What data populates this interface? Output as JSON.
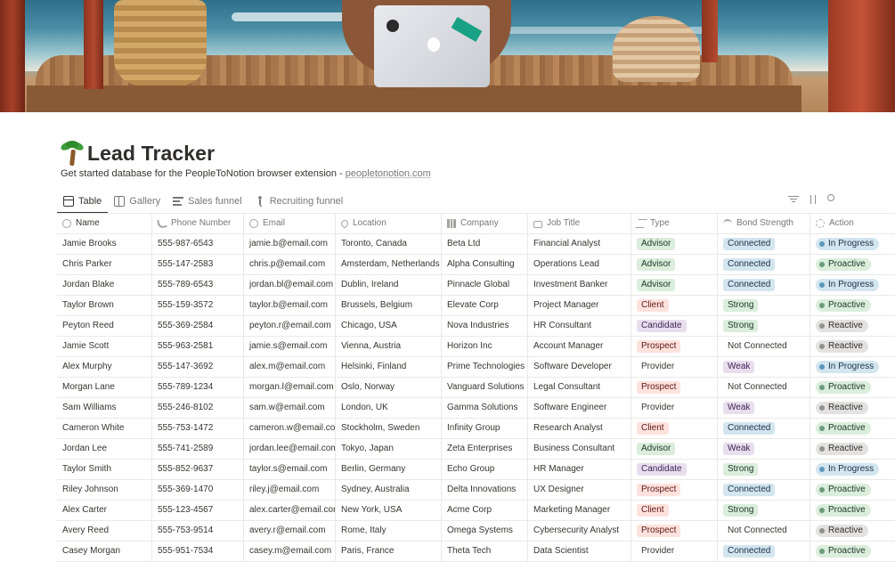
{
  "page": {
    "title": "Lead Tracker",
    "subtitle_text": "Get started database for the PeopleToNotion browser extension - ",
    "subtitle_link": "peopletonotion.com"
  },
  "tabs": [
    {
      "label": "Table",
      "icon": "table-icon",
      "active": true
    },
    {
      "label": "Gallery",
      "icon": "gallery-icon",
      "active": false
    },
    {
      "label": "Sales funnel",
      "icon": "board-icon",
      "active": false
    },
    {
      "label": "Recruiting funnel",
      "icon": "walking-person-icon",
      "active": false
    }
  ],
  "toolbar": [
    "filter-icon",
    "sort-icon",
    "search-icon"
  ],
  "columns": [
    {
      "label": "Name",
      "icon": "person-icon"
    },
    {
      "label": "Phone Number",
      "icon": "phone-icon"
    },
    {
      "label": "Email",
      "icon": "at-icon"
    },
    {
      "label": "Location",
      "icon": "location-pin-icon"
    },
    {
      "label": "Company",
      "icon": "building-icon"
    },
    {
      "label": "Job Title",
      "icon": "briefcase-icon"
    },
    {
      "label": "Type",
      "icon": "shuffle-icon"
    },
    {
      "label": "Bond Strength",
      "icon": "wifi-icon"
    },
    {
      "label": "Action",
      "icon": "loading-icon"
    }
  ],
  "colors": {
    "type": {
      "Advisor": {
        "bg": "#dbeddb",
        "fg": "#1c3829"
      },
      "Client": {
        "bg": "#ffe2dd",
        "fg": "#5d1715"
      },
      "Candidate": {
        "bg": "#e8deee",
        "fg": "#412454"
      },
      "Prospect": {
        "bg": "#ffe2dd",
        "fg": "#5d1715"
      },
      "Provider": {
        "bg": "#ffffff",
        "fg": "#37352f"
      }
    },
    "bond": {
      "Connected": {
        "bg": "#d3e5ef",
        "fg": "#183347"
      },
      "Strong": {
        "bg": "#dbeddb",
        "fg": "#1c3829"
      },
      "Not Connected": {
        "bg": "#ffffff",
        "fg": "#37352f"
      },
      "Weak": {
        "bg": "#e8deee",
        "fg": "#412454"
      }
    },
    "action": {
      "In Progress": {
        "bg": "#d3e5ef",
        "fg": "#183347",
        "dot": "#5b97bd"
      },
      "Proactive": {
        "bg": "#dbeddb",
        "fg": "#1c3829",
        "dot": "#6c9b7d"
      },
      "Reactive": {
        "bg": "#e3e2e0",
        "fg": "#32302c",
        "dot": "#91918e"
      }
    }
  },
  "rows": [
    {
      "name": "Jamie Brooks",
      "phone": "555-987-6543",
      "email": "jamie.b@email.com",
      "location": "Toronto, Canada",
      "company": "Beta Ltd",
      "job": "Financial Analyst",
      "type": "Advisor",
      "bond": "Connected",
      "action": "In Progress"
    },
    {
      "name": "Chris Parker",
      "phone": "555-147-2583",
      "email": "chris.p@email.com",
      "location": "Amsterdam, Netherlands",
      "company": "Alpha Consulting",
      "job": "Operations Lead",
      "type": "Advisor",
      "bond": "Connected",
      "action": "Proactive"
    },
    {
      "name": "Jordan Blake",
      "phone": "555-789-6543",
      "email": "jordan.bl@email.com",
      "location": "Dublin, Ireland",
      "company": "Pinnacle Global",
      "job": "Investment Banker",
      "type": "Advisor",
      "bond": "Connected",
      "action": "In Progress"
    },
    {
      "name": "Taylor Brown",
      "phone": "555-159-3572",
      "email": "taylor.b@email.com",
      "location": "Brussels, Belgium",
      "company": "Elevate Corp",
      "job": "Project Manager",
      "type": "Client",
      "bond": "Strong",
      "action": "Proactive"
    },
    {
      "name": "Peyton Reed",
      "phone": "555-369-2584",
      "email": "peyton.r@email.com",
      "location": "Chicago, USA",
      "company": "Nova Industries",
      "job": "HR Consultant",
      "type": "Candidate",
      "bond": "Strong",
      "action": "Reactive"
    },
    {
      "name": "Jamie Scott",
      "phone": "555-963-2581",
      "email": "jamie.s@email.com",
      "location": "Vienna, Austria",
      "company": "Horizon Inc",
      "job": "Account Manager",
      "type": "Prospect",
      "bond": "Not Connected",
      "action": "Reactive"
    },
    {
      "name": "Alex Murphy",
      "phone": "555-147-3692",
      "email": "alex.m@email.com",
      "location": "Helsinki, Finland",
      "company": "Prime Technologies",
      "job": "Software Developer",
      "type": "Provider",
      "bond": "Weak",
      "action": "In Progress"
    },
    {
      "name": "Morgan Lane",
      "phone": "555-789-1234",
      "email": "morgan.l@email.com",
      "location": "Oslo, Norway",
      "company": "Vanguard Solutions",
      "job": "Legal Consultant",
      "type": "Prospect",
      "bond": "Not Connected",
      "action": "Proactive"
    },
    {
      "name": "Sam Williams",
      "phone": "555-246-8102",
      "email": "sam.w@email.com",
      "location": "London, UK",
      "company": "Gamma Solutions",
      "job": "Software Engineer",
      "type": "Provider",
      "bond": "Weak",
      "action": "Reactive"
    },
    {
      "name": "Cameron White",
      "phone": "555-753-1472",
      "email": "cameron.w@email.com",
      "location": "Stockholm, Sweden",
      "company": "Infinity Group",
      "job": "Research Analyst",
      "type": "Client",
      "bond": "Connected",
      "action": "Proactive"
    },
    {
      "name": "Jordan Lee",
      "phone": "555-741-2589",
      "email": "jordan.lee@email.com",
      "location": "Tokyo, Japan",
      "company": "Zeta Enterprises",
      "job": "Business Consultant",
      "type": "Advisor",
      "bond": "Weak",
      "action": "Reactive"
    },
    {
      "name": "Taylor Smith",
      "phone": "555-852-9637",
      "email": "taylor.s@email.com",
      "location": "Berlin, Germany",
      "company": "Echo Group",
      "job": "HR Manager",
      "type": "Candidate",
      "bond": "Strong",
      "action": "In Progress"
    },
    {
      "name": "Riley Johnson",
      "phone": "555-369-1470",
      "email": "riley.j@email.com",
      "location": "Sydney, Australia",
      "company": "Delta Innovations",
      "job": "UX Designer",
      "type": "Prospect",
      "bond": "Connected",
      "action": "Proactive"
    },
    {
      "name": "Alex Carter",
      "phone": "555-123-4567",
      "email": "alex.carter@email.com",
      "location": "New York, USA",
      "company": "Acme Corp",
      "job": "Marketing Manager",
      "type": "Client",
      "bond": "Strong",
      "action": "Proactive"
    },
    {
      "name": "Avery Reed",
      "phone": "555-753-9514",
      "email": "avery.r@email.com",
      "location": "Rome, Italy",
      "company": "Omega Systems",
      "job": "Cybersecurity Analyst",
      "type": "Prospect",
      "bond": "Not Connected",
      "action": "Reactive"
    },
    {
      "name": "Casey Morgan",
      "phone": "555-951-7534",
      "email": "casey.m@email.com",
      "location": "Paris, France",
      "company": "Theta Tech",
      "job": "Data Scientist",
      "type": "Provider",
      "bond": "Connected",
      "action": "Proactive"
    }
  ]
}
